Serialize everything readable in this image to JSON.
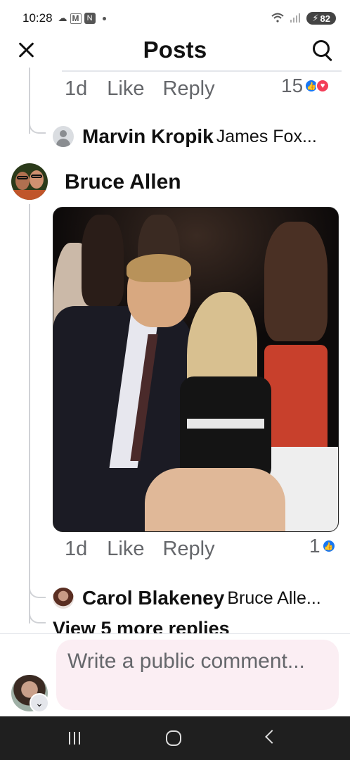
{
  "status_bar": {
    "time": "10:28",
    "battery": "82"
  },
  "header": {
    "title": "Posts"
  },
  "comment_top": {
    "time": "1d",
    "like_label": "Like",
    "reply_label": "Reply",
    "reaction_count": "15",
    "reply_preview": {
      "author": "Marvin Kropik",
      "text": "James Fox..."
    }
  },
  "comment_main": {
    "author": "Bruce Allen",
    "time": "1d",
    "like_label": "Like",
    "reply_label": "Reply",
    "reaction_count": "1",
    "reply_preview": {
      "author": "Carol Blakeney",
      "text": "Bruce Alle..."
    },
    "view_more": "View 5 more replies"
  },
  "composer": {
    "placeholder": "Write a public comment..."
  },
  "colors": {
    "like_blue": "#1877f2",
    "love_red": "#f33e58",
    "composer_bg": "#fbeef3"
  }
}
